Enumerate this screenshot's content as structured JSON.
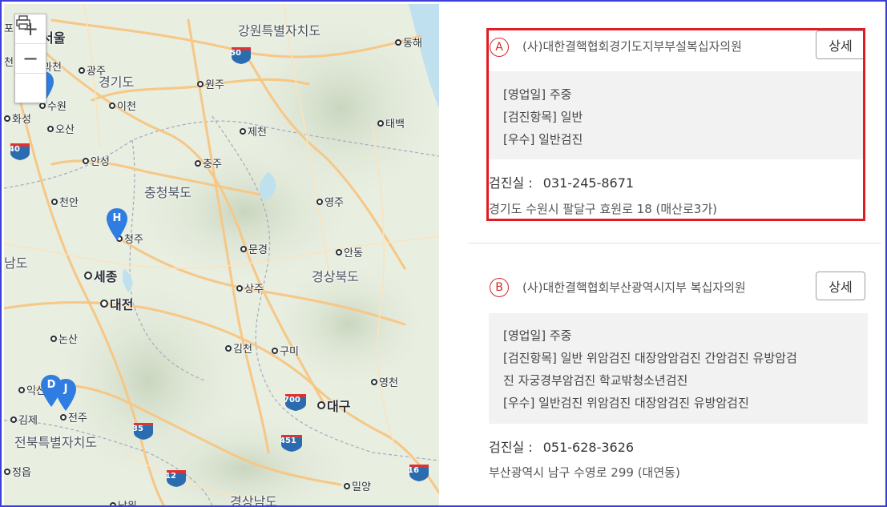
{
  "map": {
    "zoom_in": "+",
    "zoom_out": "−",
    "print_icon": "printer-icon",
    "regions": [
      "강원특별자치도",
      "경기도",
      "충청북도",
      "경상북도",
      "전북특별자치도",
      "경상남도",
      "남도"
    ],
    "cities": [
      "서울",
      "과천",
      "광주",
      "원주",
      "동해",
      "수원",
      "이천",
      "화성",
      "오산",
      "제천",
      "태백",
      "안성",
      "충주",
      "천안",
      "영주",
      "청주",
      "문경",
      "안동",
      "세종",
      "상주",
      "대전",
      "논산",
      "김천",
      "구미",
      "영천",
      "익산",
      "대구",
      "김제",
      "전주",
      "정읍",
      "밀양",
      "남원"
    ],
    "edge_labels": [
      "포",
      "천"
    ],
    "highways": [
      "50",
      "40",
      "700",
      "35",
      "451",
      "12",
      "16"
    ],
    "pins": [
      "H",
      "D",
      "J"
    ]
  },
  "results": [
    {
      "marker": "A",
      "name": "(사)대한결핵협회경기도지부부설복십자의원",
      "detail_label": "상세",
      "info": [
        "[영업일] 주중",
        "[검진항목] 일반",
        "[우수] 일반검진"
      ],
      "phone_label": "검진실 :",
      "phone": "031-245-8671",
      "address": "경기도 수원시 팔달구 효원로 18 (매산로3가)"
    },
    {
      "marker": "B",
      "name": "(사)대한결핵협회부산광역시지부 복십자의원",
      "detail_label": "상세",
      "info": [
        "[영업일] 주중",
        "[검진항목] 일반 위암검진 대장암암검진 간암검진 유방암검",
        "진 자궁경부암검진 학교밖청소년검진",
        "[우수] 일반검진 위암검진 대장암검진 유방암검진"
      ],
      "phone_label": "검진실 :",
      "phone": "051-628-3626",
      "address": "부산광역시 남구 수영로 299 (대연동)"
    }
  ],
  "colors": {
    "highlight": "#e31b23",
    "marker": "#d12a2a",
    "pin": "#2f7de1",
    "highway": "#2b6cb0",
    "frame": "#3b3fd8"
  }
}
